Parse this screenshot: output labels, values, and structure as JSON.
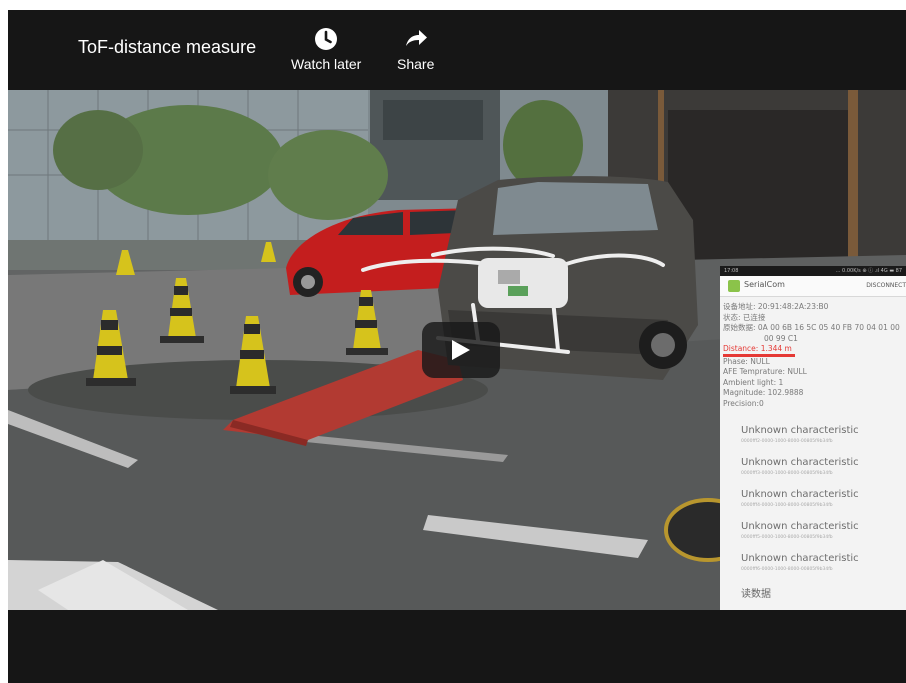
{
  "video": {
    "title": "ToF-distance measure",
    "watch_later_label": "Watch later",
    "share_label": "Share",
    "play_label": "Play"
  },
  "overlay_app": {
    "status_time": "17:08",
    "status_right": "... 0.00K/s ⊕ ⓘ .ıl 4G ▬ 87",
    "app_name": "SerialCom",
    "disconnect_label": "DISCONNECT",
    "device_address": "设备地址: 20:91:48:2A:23:B0",
    "status": "状态: 已连接",
    "raw_data_line1": "原始数据: 0A 00 6B 16 5C 05 40 FB 70 04 01 00",
    "raw_data_line2": "00 99 C1",
    "distance": "Distance: 1.344 m",
    "phase": "Phase: NULL",
    "afe_temperature": "AFE Temprature: NULL",
    "ambient_light": "Ambient light: 1",
    "magnitude": "Magnitude: 102.9888",
    "precision": "Precision:0",
    "characteristics": [
      {
        "title": "Unknown characteristic",
        "uuid": "0000fff2-0000-1000-8000-00805f9b34fb"
      },
      {
        "title": "Unknown characteristic",
        "uuid": "0000fff3-0000-1000-8000-00805f9b34fb"
      },
      {
        "title": "Unknown characteristic",
        "uuid": "0000fff4-0000-1000-8000-00805f9b34fb"
      },
      {
        "title": "Unknown characteristic",
        "uuid": "0000fff5-0000-1000-8000-00805f9b34fb"
      },
      {
        "title": "Unknown characteristic",
        "uuid": "0000fff6-0000-1000-8000-00805f9b34fb"
      }
    ],
    "read_data_label": "读数据"
  }
}
